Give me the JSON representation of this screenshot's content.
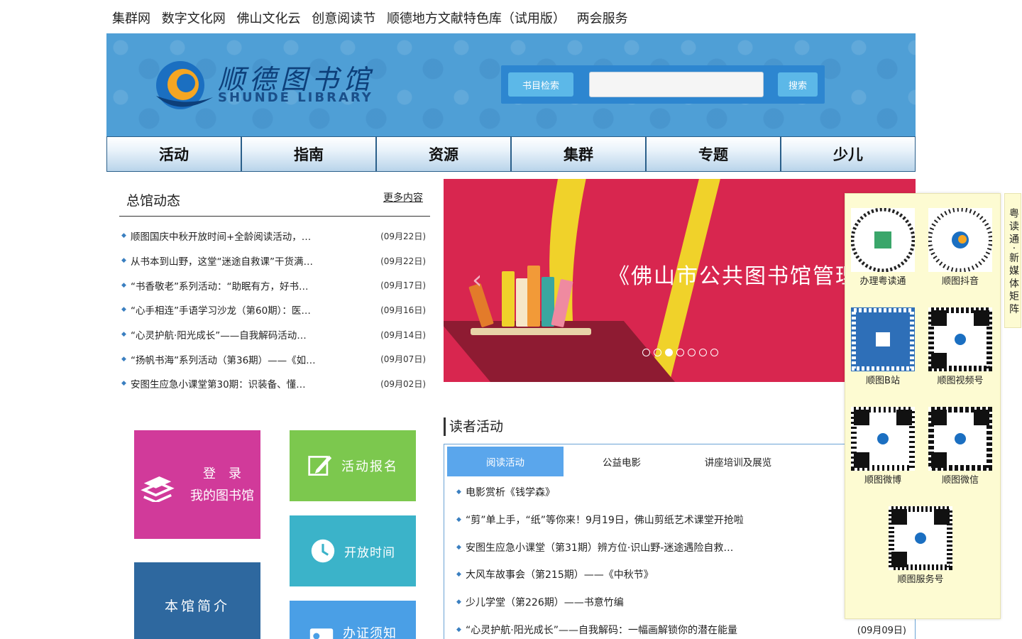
{
  "top_links": [
    "集群网",
    "数字文化网",
    "佛山文化云",
    "创意阅读节",
    "顺德地方文献特色库（试用版）",
    "两会服务"
  ],
  "header": {
    "logo_text": "顺德图书馆",
    "logo_sub": "SHUNDE LIBRARY",
    "search_type": "书目检索",
    "search_button": "搜索",
    "search_placeholder": ""
  },
  "nav": [
    "活动",
    "指南",
    "资源",
    "集群",
    "专题",
    "少儿"
  ],
  "news": {
    "title": "总馆动态",
    "more": "更多内容",
    "items": [
      {
        "text": "顺图国庆中秋开放时间+全龄阅读活动，…",
        "date": "(09月22日)"
      },
      {
        "text": "从书本到山野，这堂“迷途自救课”干货满…",
        "date": "(09月22日)"
      },
      {
        "text": "“书香敬老”系列活动：“助眠有方，好书…",
        "date": "(09月17日)"
      },
      {
        "text": "“心手相连”手语学习沙龙（第60期）：医…",
        "date": "(09月16日)"
      },
      {
        "text": "“心灵护航·阳光成长”——自我解码活动…",
        "date": "(09月14日)"
      },
      {
        "text": "“扬帆书海”系列活动（第36期）——《如…",
        "date": "(09月07日)"
      },
      {
        "text": "安图生应急小课堂第30期：识装备、懂…",
        "date": "(09月02日)"
      }
    ]
  },
  "banner": {
    "text": "《佛山市公共图书馆管理办",
    "dots": 7,
    "active_dot": 2
  },
  "tiles": {
    "login_line1": "登　录",
    "login_line2": "我的图书馆",
    "activity": "活动报名",
    "hours": "开放时间",
    "intro": "本馆简介",
    "card": "办证须知"
  },
  "reader": {
    "title": "读者活动",
    "tabs": [
      "阅读活动",
      "公益电影",
      "讲座培训及展览"
    ],
    "items": [
      {
        "text": "电影赏析《钱学森》",
        "date": ""
      },
      {
        "text": "“剪”单上手，“纸”等你来！9月19日，佛山剪纸艺术课堂开抢啦",
        "date": ""
      },
      {
        "text": "安图生应急小课堂（第31期）辨方位·识山野-迷途遇险自救…",
        "date": ""
      },
      {
        "text": "大风车故事会（第215期）——《中秋节》",
        "date": ""
      },
      {
        "text": "少儿学堂（第226期）——书意竹编",
        "date": ""
      },
      {
        "text": "“心灵护航·阳光成长”——自我解码：一幅画解锁你的潜在能量",
        "date": "(09月09日)"
      }
    ]
  },
  "qr": [
    "办理粤读通",
    "顺图抖音",
    "顺图B站",
    "顺图视频号",
    "顺图微博",
    "顺图微信",
    "顺图服务号"
  ],
  "side_tab": "粤读通·新媒体矩阵",
  "colors": {
    "header_bg": "#4f9fd6",
    "banner_bg": "#d8264f",
    "tile_login": "#d13a9a",
    "tile_activity": "#7cc84e",
    "tile_hours": "#3bb3c9",
    "tile_intro": "#2e689f",
    "tile_card": "#4a9fe6",
    "tab_active": "#5aa6ec"
  }
}
